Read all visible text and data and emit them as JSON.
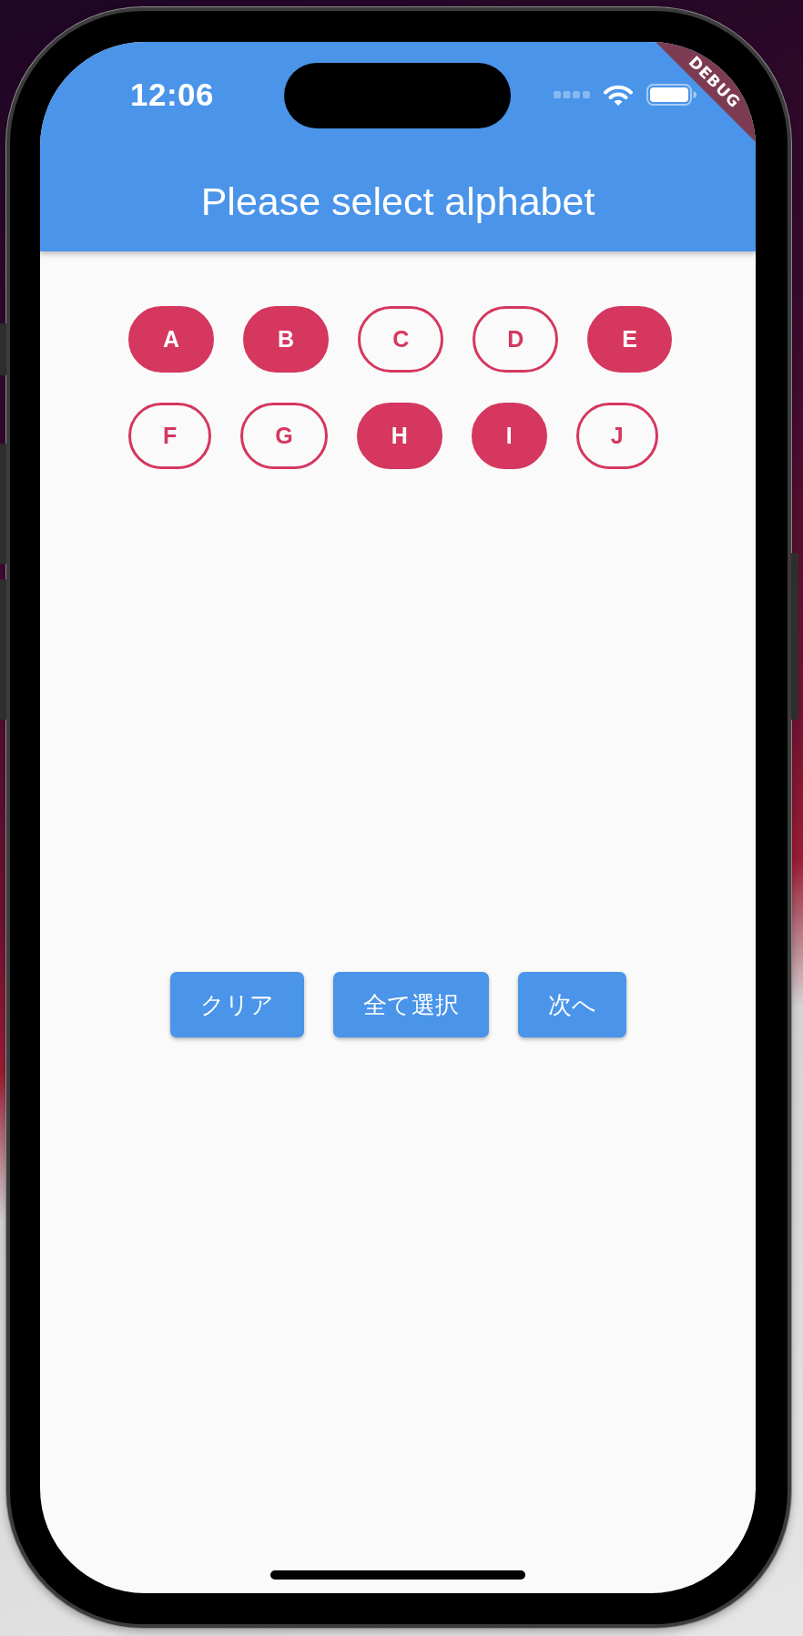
{
  "status_bar": {
    "time": "12:06"
  },
  "debug_banner": {
    "label": "DEBUG"
  },
  "app_bar": {
    "title": "Please select alphabet"
  },
  "chips": [
    {
      "label": "A",
      "selected": true
    },
    {
      "label": "B",
      "selected": true
    },
    {
      "label": "C",
      "selected": false
    },
    {
      "label": "D",
      "selected": false
    },
    {
      "label": "E",
      "selected": true
    },
    {
      "label": "F",
      "selected": false
    },
    {
      "label": "G",
      "selected": false
    },
    {
      "label": "H",
      "selected": true
    },
    {
      "label": "I",
      "selected": true
    },
    {
      "label": "J",
      "selected": false
    }
  ],
  "buttons": [
    {
      "label": "クリア"
    },
    {
      "label": "全て選択"
    },
    {
      "label": "次へ"
    }
  ]
}
